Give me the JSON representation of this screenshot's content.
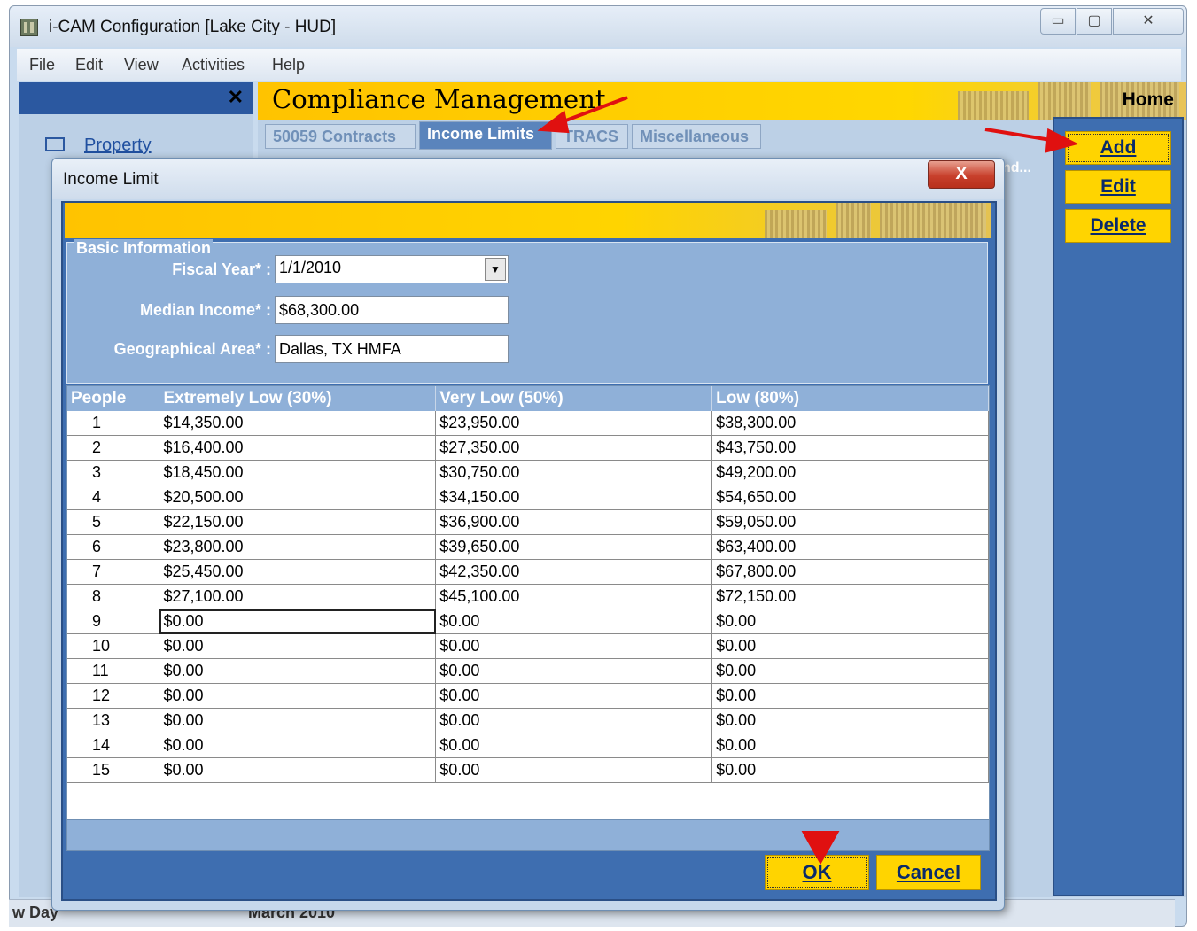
{
  "window": {
    "title": "i-CAM Configuration [Lake City - HUD]",
    "controls": {
      "minimize": "▭",
      "maximize": "▢",
      "close": "✕"
    }
  },
  "menu": [
    "File",
    "Edit",
    "View",
    "Activities",
    "Help"
  ],
  "left_panel": {
    "close_glyph": "✕",
    "items": [
      {
        "label": "Property",
        "icon": "property-icon"
      }
    ]
  },
  "compliance": {
    "title": "Compliance Management",
    "home": "Home",
    "tabs": [
      {
        "label": "50059 Contracts",
        "active": false
      },
      {
        "label": "Income Limits",
        "active": true
      },
      {
        "label": "TRACS",
        "active": false
      },
      {
        "label": "Miscellaneous",
        "active": false
      }
    ],
    "grid_header_fragment": "nd...",
    "side_buttons": [
      "Add",
      "Edit",
      "Delete"
    ]
  },
  "status": {
    "left": "w Day",
    "middle": "March 2010"
  },
  "dialog": {
    "title": "Income Limit",
    "close_glyph": "X",
    "basic_info": {
      "legend": "Basic Information",
      "fiscal_year_label": "Fiscal Year* :",
      "fiscal_year_value": "1/1/2010",
      "median_income_label": "Median Income* :",
      "median_income_value": "$68,300.00",
      "geo_area_label": "Geographical Area* :",
      "geo_area_value": "Dallas, TX HMFA"
    },
    "grid": {
      "columns": [
        "People",
        "Extremely Low (30%)",
        "Very Low (50%)",
        "Low (80%)"
      ],
      "rows": [
        [
          "1",
          "$14,350.00",
          "$23,950.00",
          "$38,300.00"
        ],
        [
          "2",
          "$16,400.00",
          "$27,350.00",
          "$43,750.00"
        ],
        [
          "3",
          "$18,450.00",
          "$30,750.00",
          "$49,200.00"
        ],
        [
          "4",
          "$20,500.00",
          "$34,150.00",
          "$54,650.00"
        ],
        [
          "5",
          "$22,150.00",
          "$36,900.00",
          "$59,050.00"
        ],
        [
          "6",
          "$23,800.00",
          "$39,650.00",
          "$63,400.00"
        ],
        [
          "7",
          "$25,450.00",
          "$42,350.00",
          "$67,800.00"
        ],
        [
          "8",
          "$27,100.00",
          "$45,100.00",
          "$72,150.00"
        ],
        [
          "9",
          "$0.00",
          "$0.00",
          "$0.00"
        ],
        [
          "10",
          "$0.00",
          "$0.00",
          "$0.00"
        ],
        [
          "11",
          "$0.00",
          "$0.00",
          "$0.00"
        ],
        [
          "12",
          "$0.00",
          "$0.00",
          "$0.00"
        ],
        [
          "13",
          "$0.00",
          "$0.00",
          "$0.00"
        ],
        [
          "14",
          "$0.00",
          "$0.00",
          "$0.00"
        ],
        [
          "15",
          "$0.00",
          "$0.00",
          "$0.00"
        ]
      ]
    },
    "buttons": {
      "ok": "OK",
      "cancel": "Cancel"
    }
  },
  "colors": {
    "accent_yellow": "#ffd400",
    "panel_blue": "#3e6eb0",
    "annotation_red": "#e01010"
  }
}
